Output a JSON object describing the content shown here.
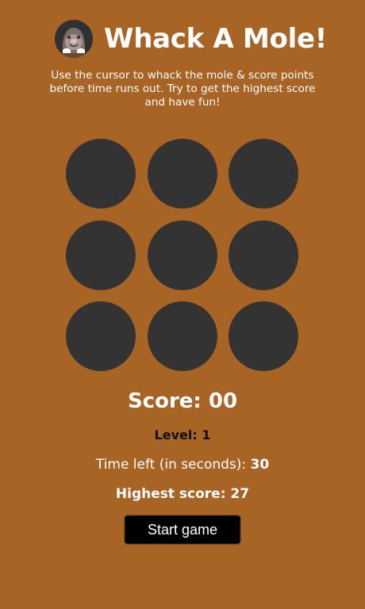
{
  "header": {
    "title": "Whack A Mole!",
    "logo_icon": "mole-icon"
  },
  "description": "Use the cursor to whack the mole & score points before time runs out. Try to get the highest score and have fun!",
  "board": {
    "rows": 3,
    "columns": 3,
    "holes": 9
  },
  "stats": {
    "score_label": "Score:",
    "score_value": "00",
    "level_label": "Level:",
    "level_value": "1",
    "time_label": "Time left (in seconds):",
    "time_value": "30",
    "highest_label": "Highest score:",
    "highest_value": "27"
  },
  "actions": {
    "start_label": "Start game"
  },
  "colors": {
    "background": "#a86425",
    "hole": "#333333",
    "text": "#ffffff",
    "level_text": "#111111",
    "button": "#000000"
  }
}
